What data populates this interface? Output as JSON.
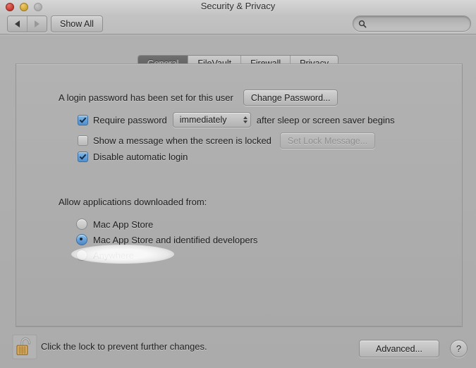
{
  "window": {
    "title": "Security & Privacy",
    "traffic_lights": [
      "close-button",
      "minimize-button",
      "zoom-button"
    ]
  },
  "toolbar": {
    "back_icon": "triangle-left-icon",
    "forward_icon": "triangle-right-icon",
    "show_all_label": "Show All",
    "search": {
      "placeholder": "",
      "value": "",
      "icon": "search-icon"
    }
  },
  "tabs": [
    {
      "label": "General",
      "active": true
    },
    {
      "label": "FileVault",
      "active": false
    },
    {
      "label": "Firewall",
      "active": false
    },
    {
      "label": "Privacy",
      "active": false
    }
  ],
  "general": {
    "password_status_text": "A login password has been set for this user",
    "change_password_label": "Change Password...",
    "require_password": {
      "checked": true,
      "label_before": "Require password",
      "delay_value": "immediately",
      "label_after": "after sleep or screen saver begins"
    },
    "show_message": {
      "checked": false,
      "label": "Show a message when the screen is locked",
      "button_label": "Set Lock Message...",
      "button_disabled": true
    },
    "disable_automatic_login": {
      "checked": true,
      "label": "Disable automatic login"
    },
    "allow_apps_label": "Allow applications downloaded from:",
    "allow_apps_options": [
      {
        "label": "Mac App Store",
        "selected": false
      },
      {
        "label": "Mac App Store and identified developers",
        "selected": true
      },
      {
        "label": "Anywhere",
        "selected": false,
        "highlighted": true
      }
    ]
  },
  "bottom": {
    "lock_icon": "unlocked-padlock-icon",
    "lock_note": "Click the lock to prevent further changes.",
    "advanced_label": "Advanced...",
    "help_label": "?"
  },
  "colors": {
    "accent_blue": "#4a87c8",
    "window_bg": "#ababab",
    "box_bg": "#b0b0b0",
    "active_tab_bg": "#686868",
    "lock_body": "#c79a52",
    "highlight": "#ffffff"
  }
}
